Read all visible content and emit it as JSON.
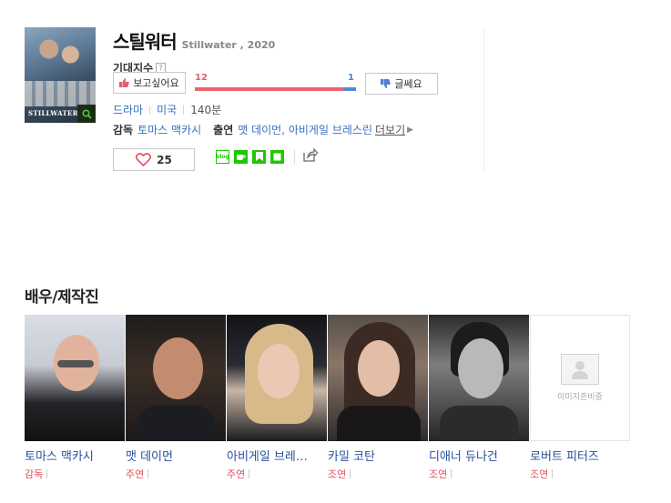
{
  "movie": {
    "title_ko": "스틸워터",
    "title_en": "Stillwater , 2020",
    "poster_caption": "STILLWATER",
    "expect_label": "기대지수",
    "help_mark": "?",
    "want_label": "보고싶어요",
    "want_count": "12",
    "meh_count": "1",
    "want_ratio": 0.92,
    "meh_label": "글쎄요",
    "genre": "드라마",
    "country": "미국",
    "runtime": "140분",
    "director_key": "감독",
    "director": "토마스 맥카시",
    "cast_key": "출연",
    "cast_names": "맷 데이먼, 아비게일 브레스린",
    "more_label": "더보기",
    "like_count": "25"
  },
  "share": {
    "icons": [
      "blog-icon",
      "cafe-icon",
      "bookmark-icon",
      "memo-icon",
      "share-icon"
    ],
    "blog_text": "blog"
  },
  "colors": {
    "want": "#f0626c",
    "meh": "#4f8ad7",
    "link": "#3a6fc2",
    "role": "#e0515c",
    "naver_green": "#1ec800"
  },
  "cast_section": {
    "title": "배우/제작진",
    "members": [
      {
        "name": "토마스 맥카시",
        "role": "감독"
      },
      {
        "name": "맷 데이먼",
        "role": "주연"
      },
      {
        "name": "아비게일 브레…",
        "role": "주연"
      },
      {
        "name": "카밀 코탄",
        "role": "조연"
      },
      {
        "name": "디애너 듀나건",
        "role": "조연"
      },
      {
        "name": "로버트 피터즈",
        "role": "조연"
      }
    ],
    "no_image_text": "이미지준비중"
  }
}
